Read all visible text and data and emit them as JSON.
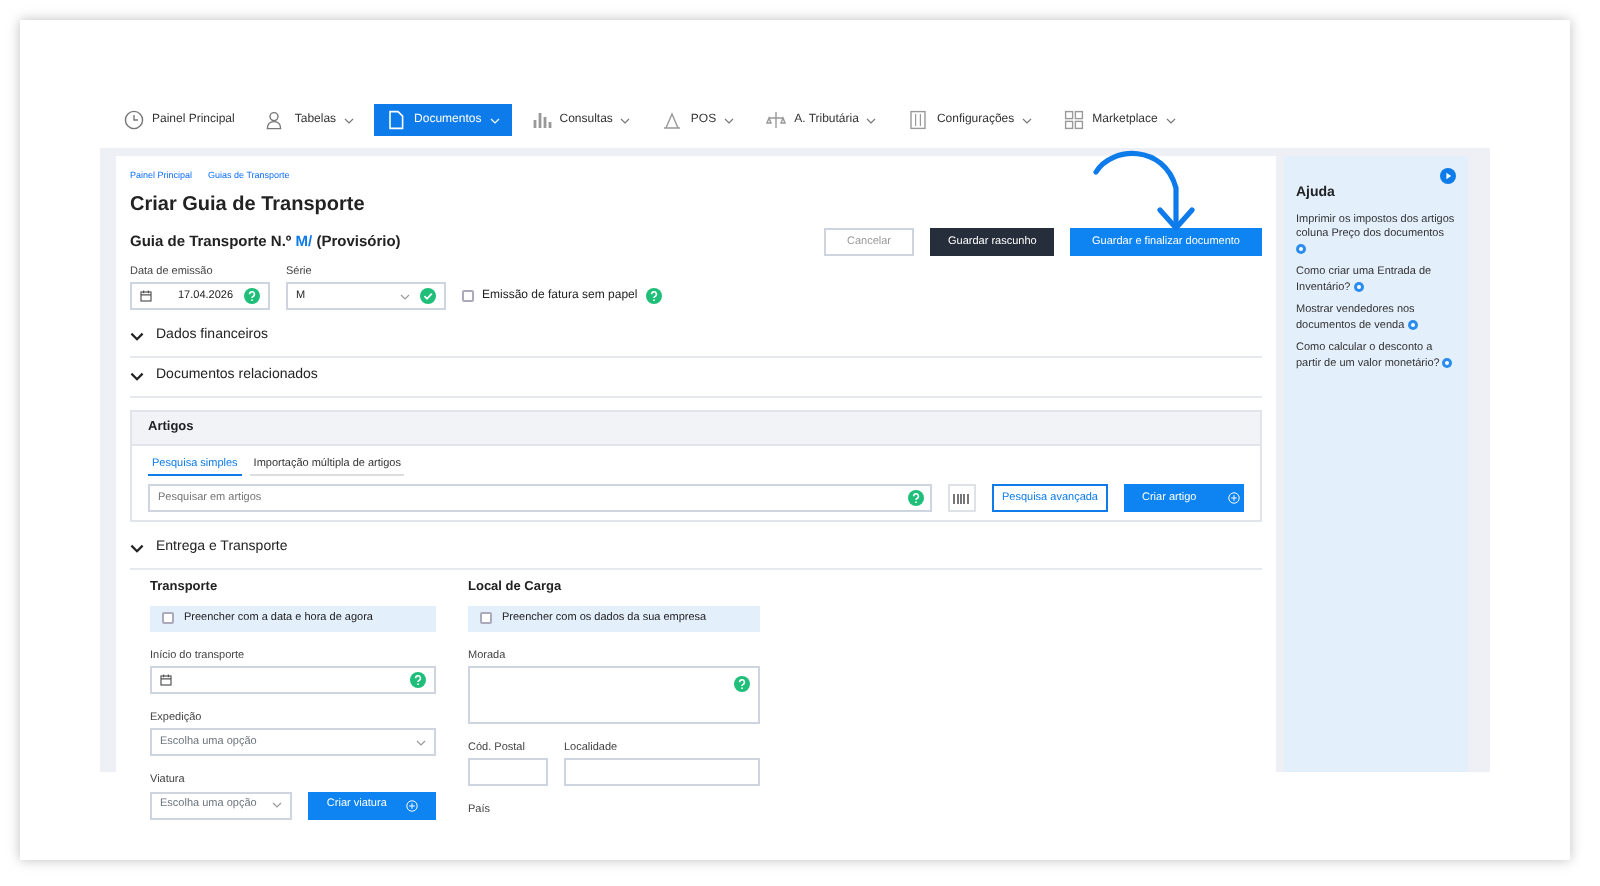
{
  "nav": [
    {
      "label": "Painel Principal",
      "dropdown": false,
      "selected": false
    },
    {
      "label": "Tabelas",
      "dropdown": true,
      "selected": false
    },
    {
      "label": "Documentos",
      "dropdown": true,
      "selected": true
    },
    {
      "label": "Consultas",
      "dropdown": true,
      "selected": false
    },
    {
      "label": "POS",
      "dropdown": true,
      "selected": false
    },
    {
      "label": "A. Tributária",
      "dropdown": true,
      "selected": false
    },
    {
      "label": "Configurações",
      "dropdown": true,
      "selected": false
    },
    {
      "label": "Marketplace",
      "dropdown": true,
      "selected": false
    }
  ],
  "breadcrumb": [
    "Painel Principal",
    "Guias de Transporte"
  ],
  "title": "Criar Guia de Transporte",
  "document": {
    "prefix": "Guia de Transporte N.º",
    "series": "M/",
    "suffix": "(Provisório)"
  },
  "buttons": [
    {
      "label": "Cancelar",
      "kind": "outline"
    },
    {
      "label": "Guardar rascunho",
      "kind": "dark"
    },
    {
      "label": "Guardar e finalizar documento",
      "kind": "primary"
    }
  ],
  "issue_date": {
    "label": "Data de emissão",
    "value": "17.04.2026"
  },
  "series": {
    "label": "Série",
    "value": "M"
  },
  "paperless": {
    "label": "Emissão de fatura sem papel",
    "checked": false
  },
  "sections": [
    "Dados financeiros",
    "Documentos relacionados"
  ],
  "articles": {
    "title": "Artigos",
    "tabs": [
      {
        "label": "Pesquisa simples",
        "selected": true
      },
      {
        "label": "Importação múltipla de artigos",
        "selected": false
      }
    ],
    "placeholder": "Pesquisar em artigos",
    "advanced": "Pesquisa avançada",
    "create": "Criar artigo"
  },
  "delivery": {
    "label": "Entrega e Transporte",
    "transport": {
      "title": "Transporte",
      "fill": {
        "label": "Preencher com a data e hora de agora",
        "checked": false
      },
      "start_label": "Início do transporte",
      "dispatch_label": "Expedição",
      "dispatch_value": "Escolha uma opção",
      "vehicle_label": "Viatura",
      "vehicle_value": "Escolha uma opção",
      "create_vehicle": "Criar viatura"
    },
    "loading": {
      "title": "Local de Carga",
      "fill": {
        "label": "Preencher com os dados da sua empresa",
        "checked": false
      },
      "address_label": "Morada",
      "postal_label": "Cód. Postal",
      "city_label": "Localidade",
      "country_label": "País"
    }
  },
  "help": {
    "title": "Ajuda",
    "links": [
      "Imprimir os impostos dos artigos coluna Preço dos documentos",
      "Como criar uma Entrada de Inventário?",
      "Mostrar vendedores nos documentos de venda",
      "Como calcular o desconto a partir de um valor monetário?"
    ]
  }
}
